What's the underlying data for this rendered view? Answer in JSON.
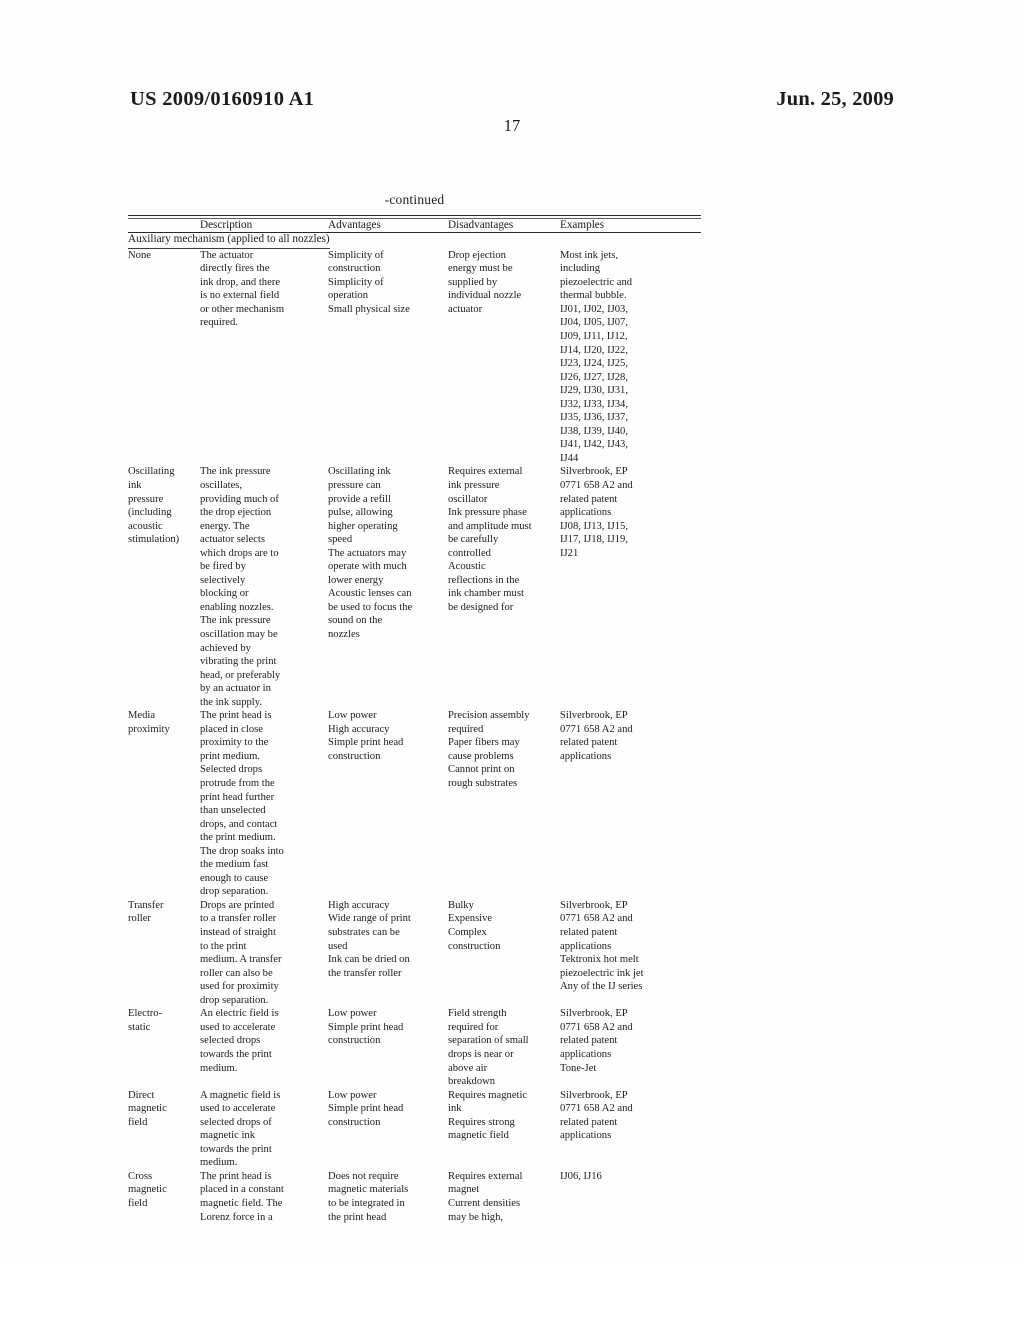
{
  "header": {
    "publication_number": "US 2009/0160910 A1",
    "publication_date": "Jun. 25, 2009",
    "page_number": "17"
  },
  "table": {
    "continued_label": "-continued",
    "columns": [
      "",
      "Description",
      "Advantages",
      "Disadvantages",
      "Examples"
    ],
    "section_heading": "Auxiliary mechanism (applied to all nozzles)",
    "rows": [
      {
        "label": "None",
        "description": "The actuator\ndirectly fires the\nink drop, and there\nis no external field\nor other mechanism\nrequired.",
        "advantages": "Simplicity of\nconstruction\nSimplicity of\noperation\nSmall physical size",
        "disadvantages": "Drop ejection\nenergy must be\nsupplied by\nindividual nozzle\nactuator",
        "examples": "Most ink jets,\nincluding\npiezoelectric and\nthermal bubble.\nIJ01, IJ02, IJ03,\nIJ04, IJ05, IJ07,\nIJ09, IJ11, IJ12,\nIJ14, IJ20, IJ22,\nIJ23, IJ24, IJ25,\nIJ26, IJ27, IJ28,\nIJ29, IJ30, IJ31,\nIJ32, IJ33, IJ34,\nIJ35, IJ36, IJ37,\nIJ38, IJ39, IJ40,\nIJ41, IJ42, IJ43,\nIJ44"
      },
      {
        "label": "Oscillating\nink\npressure\n(including\nacoustic\nstimulation)",
        "description": "The ink pressure\noscillates,\nproviding much of\nthe drop ejection\nenergy. The\nactuator selects\nwhich drops are to\nbe fired by\nselectively\nblocking or\nenabling nozzles.\nThe ink pressure\noscillation may be\nachieved by\nvibrating the print\nhead, or preferably\nby an actuator in\nthe ink supply.",
        "advantages": "Oscillating ink\npressure can\nprovide a refill\npulse, allowing\nhigher operating\nspeed\nThe actuators may\noperate with much\nlower energy\nAcoustic lenses can\nbe used to focus the\nsound on the\nnozzles",
        "disadvantages": "Requires external\nink pressure\noscillator\nInk pressure phase\nand amplitude must\nbe carefully\ncontrolled\nAcoustic\nreflections in the\nink chamber must\nbe designed for",
        "examples": "Silverbrook, EP\n0771 658 A2 and\nrelated patent\napplications\nIJ08, IJ13, IJ15,\nIJ17, IJ18, IJ19,\nIJ21"
      },
      {
        "label": "Media\nproximity",
        "description": "The print head is\nplaced in close\nproximity to the\nprint medium.\nSelected drops\nprotrude from the\nprint head further\nthan unselected\ndrops, and contact\nthe print medium.\nThe drop soaks into\nthe medium fast\nenough to cause\ndrop separation.",
        "advantages": "Low power\nHigh accuracy\nSimple print head\nconstruction",
        "disadvantages": "Precision assembly\nrequired\nPaper fibers may\ncause problems\nCannot print on\nrough substrates",
        "examples": "Silverbrook, EP\n0771 658 A2 and\nrelated patent\napplications"
      },
      {
        "label": "Transfer\nroller",
        "description": "Drops are printed\nto a transfer roller\ninstead of straight\nto the print\nmedium. A transfer\nroller can also be\nused for proximity\ndrop separation.",
        "advantages": "High accuracy\nWide range of print\nsubstrates can be\nused\nInk can be dried on\nthe transfer roller",
        "disadvantages": "Bulky\nExpensive\nComplex\nconstruction",
        "examples": "Silverbrook, EP\n0771 658 A2 and\nrelated patent\napplications\nTektronix hot melt\npiezoelectric ink jet\nAny of the IJ series"
      },
      {
        "label": "Electro-\nstatic",
        "description": "An electric field is\nused to accelerate\nselected drops\ntowards the print\nmedium.",
        "advantages": "Low power\nSimple print head\nconstruction",
        "disadvantages": "Field strength\nrequired for\nseparation of small\ndrops is near or\nabove air\nbreakdown",
        "examples": "Silverbrook, EP\n0771 658 A2 and\nrelated patent\napplications\nTone-Jet"
      },
      {
        "label": "Direct\nmagnetic\nfield",
        "description": "A magnetic field is\nused to accelerate\nselected drops of\nmagnetic ink\ntowards the print\nmedium.",
        "advantages": "Low power\nSimple print head\nconstruction",
        "disadvantages": "Requires magnetic\nink\nRequires strong\nmagnetic field",
        "examples": "Silverbrook, EP\n0771 658 A2 and\nrelated patent\napplications"
      },
      {
        "label": "Cross\nmagnetic\nfield",
        "description": "The print head is\nplaced in a constant\nmagnetic field. The\nLorenz force in a",
        "advantages": "Does not require\nmagnetic materials\nto be integrated in\nthe print head",
        "disadvantages": "Requires external\nmagnet\nCurrent densities\nmay be high,",
        "examples": "IJ06, IJ16"
      }
    ]
  }
}
